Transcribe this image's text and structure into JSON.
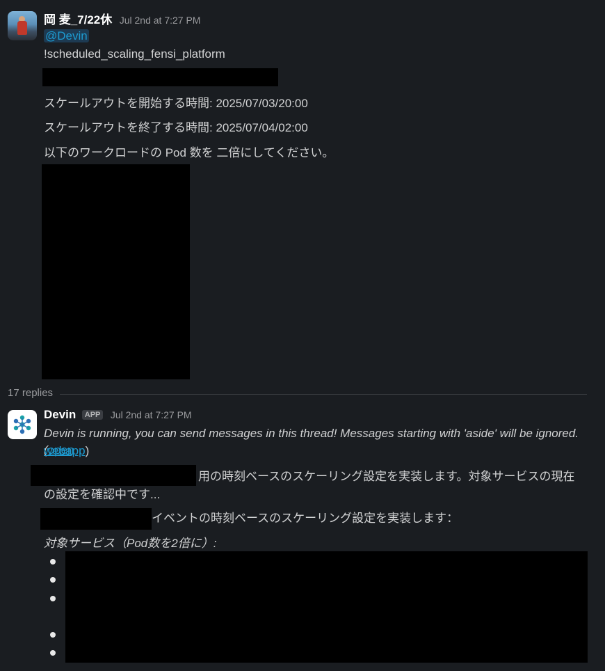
{
  "message1": {
    "sender": "岡 麦_7/22休",
    "timestamp": "Jul 2nd at 7:27 PM",
    "mention": "@Devin",
    "command": "!scheduled_scaling_fensi_platform",
    "line_start": "スケールアウトを開始する時間: 2025/07/03/20:00",
    "line_end": "スケールアウトを終了する時間: 2025/07/04/02:00",
    "line_request": "以下のワークロードの Pod 数を 二倍にしてください。"
  },
  "thread": {
    "replies_label": "17 replies"
  },
  "message2": {
    "sender": "Devin",
    "app_badge": "APP",
    "timestamp": "Jul 2nd at 7:27 PM",
    "status_text": "Devin is running, you can send messages in this thread! Messages starting with 'aside' will be ignored. (",
    "link_part1": "open",
    "link_part2": "webapp",
    "status_close": ")",
    "impl_line1": "用の時刻ベースのスケーリング設定を実装します。対象サービスの現在",
    "impl_line2": "の設定を確認中です...",
    "event_line": "イベントの時刻ベースのスケーリング設定を実装します：",
    "target_label": "対象サービス（Pod数を2倍に）:"
  },
  "colors": {
    "background": "#1a1d21",
    "text": "#d1d2d3",
    "link": "#1d9bd1",
    "redaction": "#000000"
  }
}
